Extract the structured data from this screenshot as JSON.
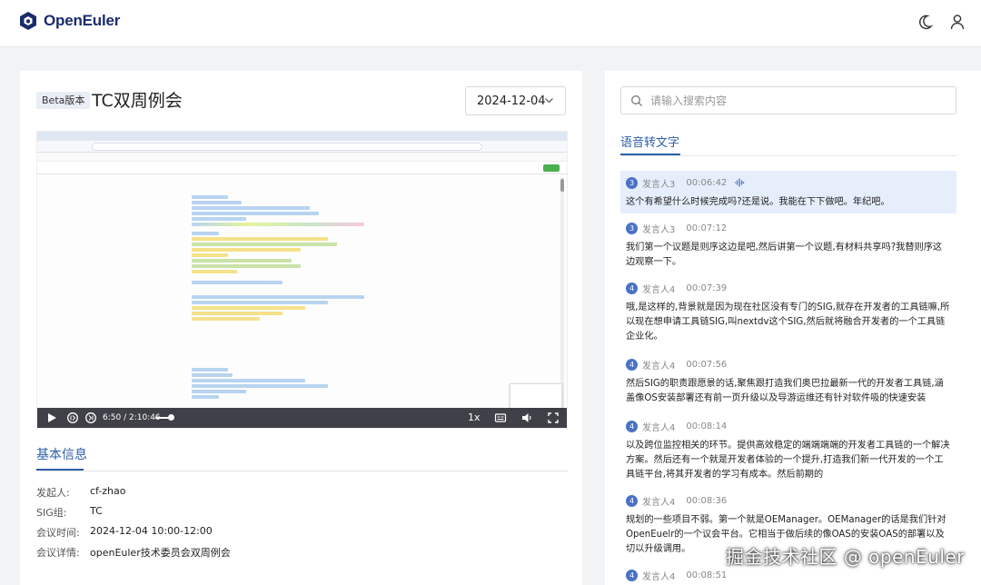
{
  "header": {
    "brand": "OpenEuler",
    "brand_color": "#1a2b6d"
  },
  "meeting": {
    "badge": "Beta版本",
    "title": "TC双周例会",
    "date": "2024-12-04",
    "video": {
      "time": "6:50 / 2:10:46",
      "speed": "1x"
    }
  },
  "info": {
    "section_title": "基本信息",
    "rows": [
      {
        "label": "发起人:",
        "value": "cf-zhao"
      },
      {
        "label": "SIG组:",
        "value": "TC"
      },
      {
        "label": "会议时间:",
        "value": "2024-12-04 10:00-12:00"
      },
      {
        "label": "会议详情:",
        "value": "openEuler技术委员会双周例会"
      }
    ]
  },
  "transcript": {
    "search_placeholder": "请输入搜索内容",
    "section_title": "语音转文字",
    "entries": [
      {
        "num": "3",
        "speaker": "发言人3",
        "time": "00:06:42",
        "text": "这个有希望什么时候完成吗?还是说。我能在下下做吧。年纪吧。"
      },
      {
        "num": "3",
        "speaker": "发言人3",
        "time": "00:07:12",
        "text": "我们第一个议题是则序这边是吧,然后讲第一个议题,有材料共享吗?我替则序这边观察一下。"
      },
      {
        "num": "4",
        "speaker": "发言人4",
        "time": "00:07:39",
        "text": "哦,是这样的,背景就是因为现在社区没有专门的SIG,就存在开发者的工具链嘛,所以现在想申请工具链SIG,叫nextdv这个SIG,然后就将融合开发者的一个工具链企业化。"
      },
      {
        "num": "4",
        "speaker": "发言人4",
        "time": "00:07:56",
        "text": "然后SIG的职责跟愿景的话,聚焦跟打造我们奥巴拉最新一代的开发者工具链,涵盖像OS安装部署还有前一页升级以及导游运维还有针对软件吸的快速安装"
      },
      {
        "num": "4",
        "speaker": "发言人4",
        "time": "00:08:14",
        "text": "以及跨位监控相关的环节。提供高效稳定的端端端端的开发者工具链的一个解决方案。然后还有一个就是开发者体验的一个提升,打造我们新一代开发的一个工具链平台,将其开发者的学习有成本。然后前期的"
      },
      {
        "num": "4",
        "speaker": "发言人4",
        "time": "00:08:36",
        "text": "规划的一些项目不弱。第一个就是OEManager。OEManager的话是我们针对OpenEuelr的一个议会平台。它相当于做后续的像OAS的安装OAS的部署以及切以升级调用。"
      },
      {
        "num": "4",
        "speaker": "发言人4",
        "time": "00:08:51",
        "text": ""
      }
    ]
  },
  "watermark": "掘金技术社区 @ openEuler"
}
